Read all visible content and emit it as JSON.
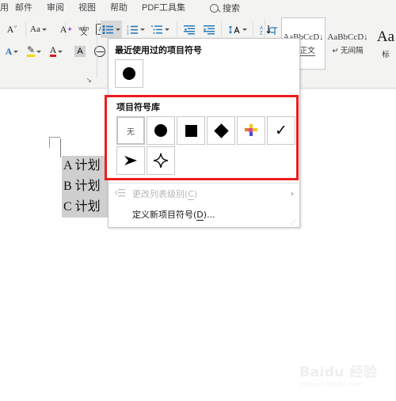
{
  "tabs": [
    {
      "label": "用"
    },
    {
      "label": "邮件"
    },
    {
      "label": "审阅"
    },
    {
      "label": "视图"
    },
    {
      "label": "帮助"
    },
    {
      "label": "PDF工具集"
    }
  ],
  "search": {
    "label": "搜索",
    "icon": "search-icon"
  },
  "ribbon": {
    "font_group": {
      "row1": [
        {
          "name": "grow-font",
          "glyph": "A"
        },
        {
          "name": "change-case",
          "glyph": "Aa"
        },
        {
          "name": "clear-formatting",
          "glyph": "A"
        },
        {
          "name": "phonetic-guide",
          "glyph": "wén"
        },
        {
          "name": "enclose-characters",
          "glyph": "A"
        }
      ],
      "row2": [
        {
          "name": "text-effects",
          "glyph": "A"
        },
        {
          "name": "text-highlight-color",
          "glyph": "pen"
        },
        {
          "name": "font-color",
          "glyph": "A"
        },
        {
          "name": "character-shading",
          "glyph": "A"
        },
        {
          "name": "character-border",
          "glyph": "circle"
        }
      ],
      "launcher": "↘"
    },
    "paragraph_group": {
      "row1": [
        {
          "name": "bullets",
          "active": true
        },
        {
          "name": "numbering",
          "active": false
        },
        {
          "name": "multilevel-list",
          "active": false
        },
        {
          "name": "decrease-indent",
          "active": false
        },
        {
          "name": "increase-indent",
          "active": false
        },
        {
          "name": "line-spacing",
          "active": false
        },
        {
          "name": "sort",
          "active": false
        },
        {
          "name": "show-formatting-marks",
          "active": false
        }
      ]
    }
  },
  "styles": [
    {
      "sample": "AaBbCcD↓",
      "name": "正文",
      "pilcrow": "↵",
      "selected": true
    },
    {
      "sample": "AaBbCcD↓",
      "name": "无间隔",
      "pilcrow": "↵",
      "selected": false
    },
    {
      "sample": "Aa",
      "name": "标",
      "pilcrow": "",
      "selected": false,
      "big": true
    }
  ],
  "document": {
    "lines": [
      "A 计划",
      "B 计划",
      "C 计划"
    ]
  },
  "bullet_dropdown": {
    "recent_title": "最近使用过的项目符号",
    "recent": [
      {
        "name": "bullet-filled-circle",
        "shape": "circle",
        "selected": false
      }
    ],
    "library_title": "项目符号库",
    "library": [
      {
        "name": "bullet-none",
        "shape": "none",
        "label": "无",
        "selected": true
      },
      {
        "name": "bullet-filled-circle",
        "shape": "circle",
        "label": "",
        "selected": false
      },
      {
        "name": "bullet-filled-square",
        "shape": "square",
        "label": "",
        "selected": false
      },
      {
        "name": "bullet-filled-diamond",
        "shape": "diamond",
        "label": "",
        "selected": false
      },
      {
        "name": "bullet-colored-flower",
        "shape": "flower",
        "label": "",
        "selected": false
      },
      {
        "name": "bullet-checkmark",
        "shape": "check",
        "label": "✓",
        "selected": false
      },
      {
        "name": "bullet-arrow",
        "shape": "arrow",
        "label": "➢",
        "selected": false
      },
      {
        "name": "bullet-four-point-star",
        "shape": "star",
        "label": "✦",
        "selected": false
      }
    ],
    "menu_items": [
      {
        "name": "change-list-level",
        "label": "更改列表级别(C)",
        "accel": "C",
        "disabled": true,
        "has_submenu": true,
        "icon": "list-level-icon",
        "arrow": "›"
      },
      {
        "name": "define-new-bullet",
        "label": "定义新项目符号(D)...",
        "accel": "D",
        "disabled": false,
        "has_submenu": false,
        "icon": "",
        "arrow": ""
      }
    ],
    "highlight_color": "#ee1c1c"
  },
  "watermark": {
    "main": "Baidu 经验",
    "sub": "jingyan.baidu.com"
  }
}
